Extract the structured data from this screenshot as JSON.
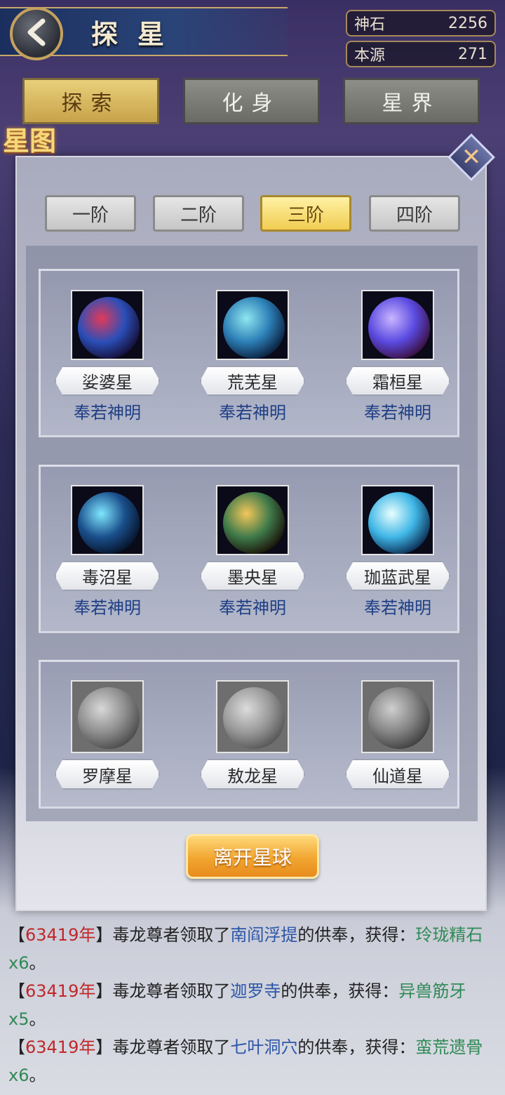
{
  "header": {
    "title": "探星"
  },
  "resources": [
    {
      "label": "神石",
      "value": "2256"
    },
    {
      "label": "本源",
      "value": "271"
    }
  ],
  "main_tabs": [
    {
      "label": "探索",
      "active": true
    },
    {
      "label": "化身",
      "active": false
    },
    {
      "label": "星界",
      "active": false
    }
  ],
  "panel": {
    "logo": "星图",
    "tiers": [
      {
        "label": "一阶",
        "active": false
      },
      {
        "label": "二阶",
        "active": false
      },
      {
        "label": "三阶",
        "active": true
      },
      {
        "label": "四阶",
        "active": false
      }
    ],
    "rows": [
      {
        "planets": [
          {
            "name": "娑婆星",
            "owner": "奉若神明",
            "locked": false,
            "colors": [
              "#e23a5a",
              "#2b4fb8",
              "#150d35"
            ]
          },
          {
            "name": "荒芜星",
            "owner": "奉若神明",
            "locked": false,
            "colors": [
              "#8fe6f0",
              "#2c7fb6",
              "#0a1d3a"
            ]
          },
          {
            "name": "霜桓星",
            "owner": "奉若神明",
            "locked": false,
            "colors": [
              "#c9b5ff",
              "#5a4ae0",
              "#3b0f3f"
            ]
          }
        ]
      },
      {
        "planets": [
          {
            "name": "毒沼星",
            "owner": "奉若神明",
            "locked": false,
            "colors": [
              "#7fe7ff",
              "#1a4f8c",
              "#061227"
            ]
          },
          {
            "name": "墨央星",
            "owner": "奉若神明",
            "locked": false,
            "colors": [
              "#f3c75a",
              "#3f7a4a",
              "#1a1208"
            ]
          },
          {
            "name": "珈蓝武星",
            "owner": "奉若神明",
            "locked": false,
            "colors": [
              "#e8ffff",
              "#3fb6e6",
              "#0b2c52"
            ]
          }
        ]
      },
      {
        "planets": [
          {
            "name": "罗摩星",
            "owner": "",
            "locked": true,
            "colors": [
              "#d8d8d8",
              "#8f8f8f",
              "#4a4a4a"
            ]
          },
          {
            "name": "敖龙星",
            "owner": "",
            "locked": true,
            "colors": [
              "#dcdcdc",
              "#9a9a9a",
              "#555555"
            ]
          },
          {
            "name": "仙道星",
            "owner": "",
            "locked": true,
            "colors": [
              "#cfcfcf",
              "#858585",
              "#3e3e3e"
            ]
          }
        ]
      }
    ],
    "leave_button": "离开星球"
  },
  "log": [
    {
      "open": "【",
      "year": "63419年",
      "close": "】",
      "actor": "毒龙尊者领取了",
      "place": "南阎浮提",
      "mid": "的供奉，获得：",
      "item": "玲珑精石x6",
      "end": "。"
    },
    {
      "open": "【",
      "year": "63419年",
      "close": "】",
      "actor": "毒龙尊者领取了",
      "place": "迦罗寺",
      "mid": "的供奉，获得：",
      "item": "异兽筋牙x5",
      "end": "。"
    },
    {
      "open": "【",
      "year": "63419年",
      "close": "】",
      "actor": "毒龙尊者领取了",
      "place": "七叶洞穴",
      "mid": "的供奉，获得：",
      "item": "蛮荒遗骨x6",
      "end": "。"
    }
  ]
}
